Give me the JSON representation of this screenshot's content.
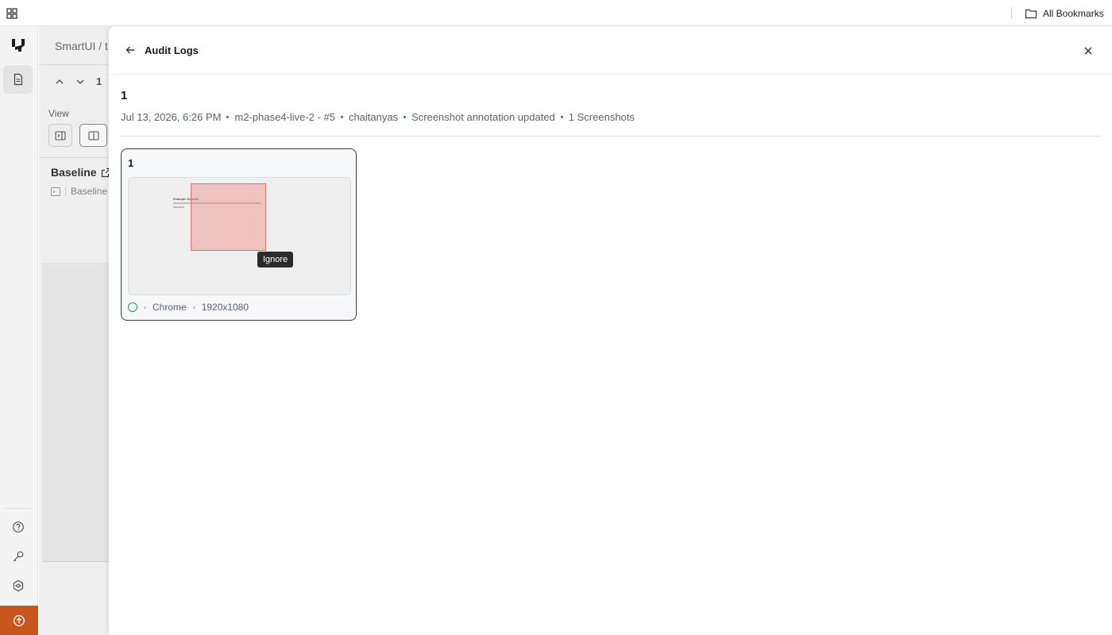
{
  "topbar": {
    "apps_icon": "grid-icon",
    "bookmarks_icon": "folder-icon",
    "bookmarks_label": "All Bookmarks"
  },
  "rail": {
    "logo_icon": "lambdatest-logo-icon",
    "items": [
      {
        "icon": "document-icon",
        "active": true
      },
      {
        "icon": "help-icon",
        "active": false
      },
      {
        "icon": "key-icon",
        "active": false
      },
      {
        "icon": "integrations-icon",
        "active": false
      }
    ],
    "upgrade_icon": "upgrade-icon",
    "upgrade_color": "#c8551e"
  },
  "background": {
    "breadcrumb": "SmartUI / t",
    "nav_counter": "1",
    "view_label": "View",
    "baseline_title": "Baseline",
    "baseline_sub": "Baseline"
  },
  "drawer": {
    "title": "Audit Logs",
    "back_icon": "arrow-left-icon",
    "close_icon": "close-icon",
    "entry": {
      "title": "1",
      "meta": [
        "Jul 13, 2026, 6:26 PM",
        "m2-phase4-live-2 - #5",
        "chaitanyas",
        "Screenshot annotation updated",
        "1 Screenshots"
      ]
    },
    "card": {
      "title": "1",
      "thumb_heading": "Example Domain",
      "region_color": "#e5706f",
      "ignore_label": "Ignore",
      "status_color": "#22a447",
      "browser": "Chrome",
      "resolution": "1920x1080"
    }
  }
}
